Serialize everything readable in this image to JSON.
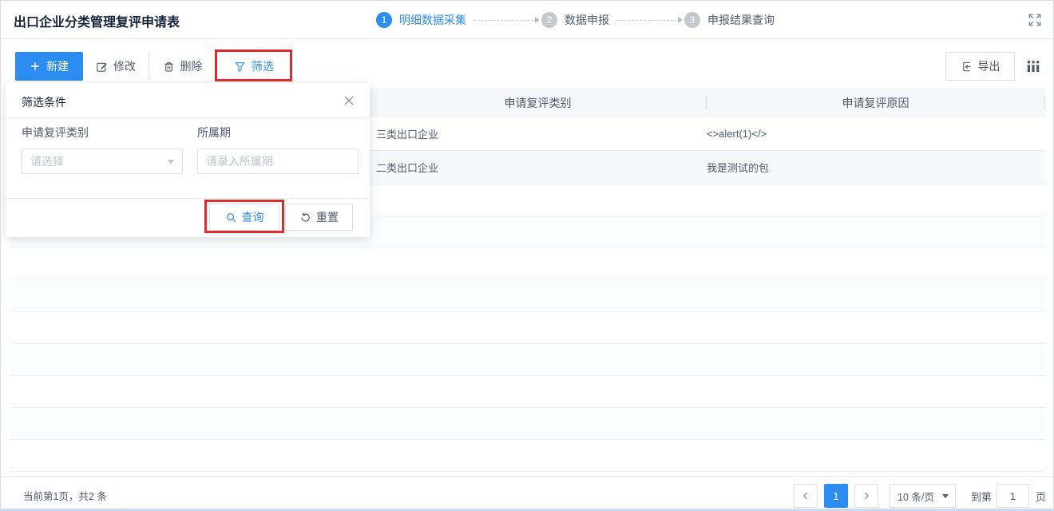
{
  "header": {
    "title": "出口企业分类管理复评申请表"
  },
  "stepper": {
    "steps": [
      {
        "num": "1",
        "label": "明细数据采集",
        "active": true
      },
      {
        "num": "2",
        "label": "数据申报",
        "active": false
      },
      {
        "num": "3",
        "label": "申报结果查询",
        "active": false
      }
    ]
  },
  "toolbar": {
    "new_label": "新建",
    "edit_label": "修改",
    "delete_label": "删除",
    "filter_label": "筛选",
    "export_label": "导出"
  },
  "filter_panel": {
    "title": "筛选条件",
    "field1_label": "申请复评类别",
    "field1_placeholder": "请选择",
    "field2_label": "所属期",
    "field2_placeholder": "请录入所属期",
    "query_label": "查询",
    "reset_label": "重置"
  },
  "table": {
    "col_category": "申请复评类别",
    "col_reason": "申请复评原因",
    "rows": [
      {
        "category": "三类出口企业",
        "reason": "<>alert(1)</>"
      },
      {
        "category": "二类出口企业",
        "reason": "我是测试的包"
      }
    ]
  },
  "pagination": {
    "summary": "当前第1页，共2 条",
    "current_page": "1",
    "page_size": "10 条/页",
    "goto_prefix": "到第",
    "goto_value": "1",
    "goto_suffix": "页"
  },
  "colors": {
    "primary": "#2d8cf0",
    "annotation_red": "#e12a2a",
    "table_header_bg": "#f4f6f9"
  }
}
